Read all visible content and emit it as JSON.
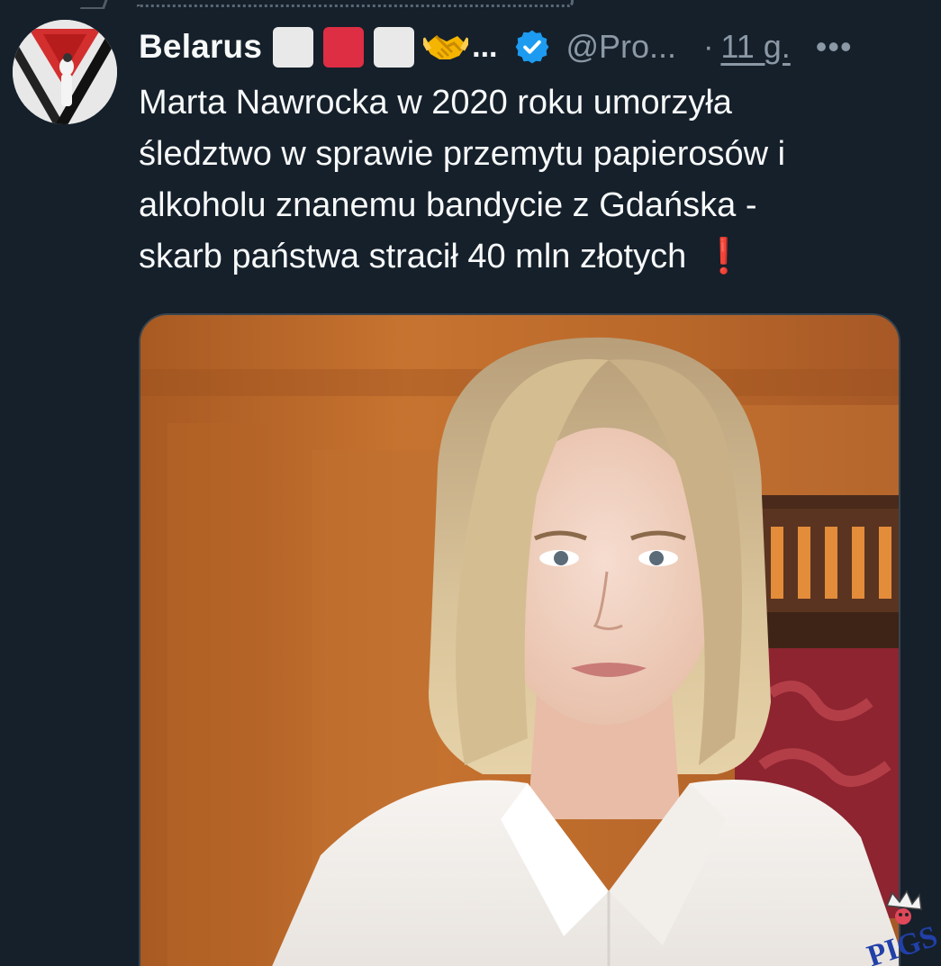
{
  "tweet": {
    "display_name": "Belarus",
    "name_truncation": "...",
    "handle": "@Pro...",
    "separator": "·",
    "timestamp": "11 g.",
    "more_label": "•••",
    "text": "Marta Nawrocka w 2020 roku umorzyła śledztwo w sprawie przemytu papierosów i alkoholu znanemu bandycie z Gdańska - skarb państwa stracił 40 mln złotych",
    "text_lines": [
      "Marta Nawrocka w 2020 roku umorzyła",
      "śledztwo w sprawie przemytu papierosów i",
      "alkoholu znanemu bandycie z Gdańska -",
      "skarb państwa stracił 40 mln złotych"
    ],
    "emoji_exclamation": "❗"
  },
  "icons": {
    "verified": "verified-badge-icon",
    "handshake": "handshake-emoji-icon",
    "flag_blocks": [
      "white",
      "red",
      "white"
    ]
  },
  "colors": {
    "background": "#15202b",
    "text": "#f7f9f9",
    "secondary_text": "#8b98a5",
    "verified": "#1d9bf0",
    "flag_red": "#dd2e44",
    "flag_white": "#e9e9e9"
  },
  "watermark": {
    "text": "PIGS"
  }
}
